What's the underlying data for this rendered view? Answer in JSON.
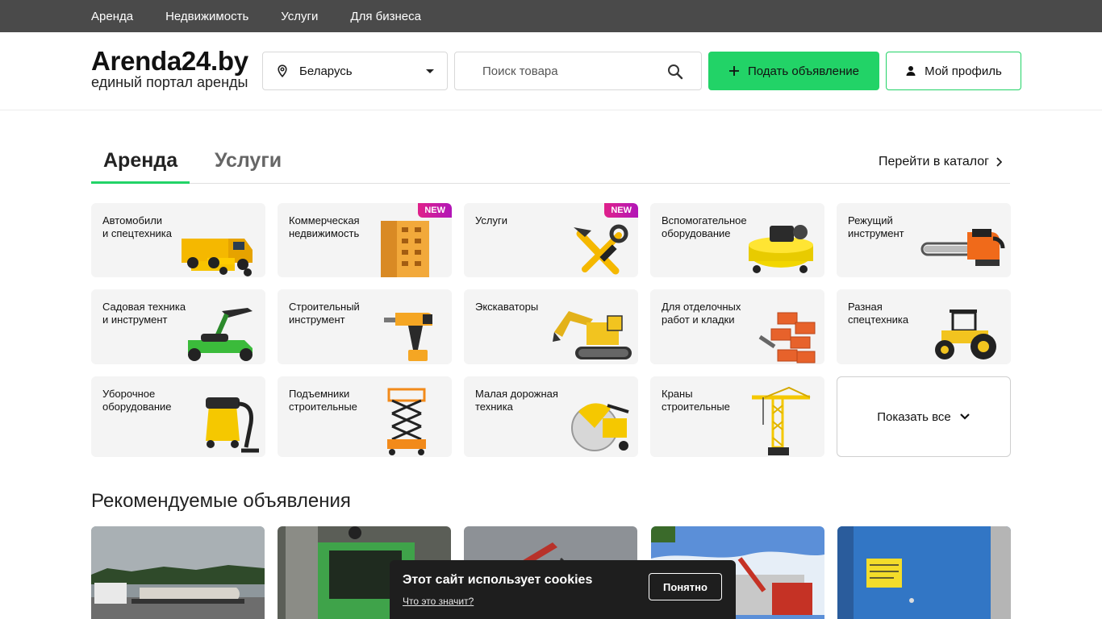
{
  "topnav": {
    "items": [
      {
        "label": "Аренда"
      },
      {
        "label": "Недвижимость"
      },
      {
        "label": "Услуги"
      },
      {
        "label": "Для бизнеса"
      }
    ]
  },
  "header": {
    "logo_title": "Arenda24.by",
    "logo_subtitle": "единый портал аренды",
    "region": "Беларусь",
    "search_placeholder": "Поиск товара",
    "post_button": "Подать объявление",
    "profile_button": "Мой профиль"
  },
  "tabs": {
    "active": "Аренда",
    "inactive": "Услуги",
    "catalog_link": "Перейти в каталог"
  },
  "categories": [
    {
      "label": "Автомобили\nи спецтехника",
      "icon": "dump-truck-icon",
      "new": false
    },
    {
      "label": "Коммерческая\nнедвижимость",
      "icon": "building-icon",
      "new": true
    },
    {
      "label": "Услуги",
      "icon": "hammer-wrench-icon",
      "new": true
    },
    {
      "label": "Вспомогательное\nоборудование",
      "icon": "compressor-icon",
      "new": false
    },
    {
      "label": "Режущий\nинструмент",
      "icon": "chainsaw-icon",
      "new": false
    },
    {
      "label": "Садовая техника\nи инструмент",
      "icon": "lawnmower-icon",
      "new": false
    },
    {
      "label": "Строительный\nинструмент",
      "icon": "drill-icon",
      "new": false
    },
    {
      "label": "Экскаваторы",
      "icon": "excavator-icon",
      "new": false
    },
    {
      "label": "Для отделочных\nработ и кладки",
      "icon": "bricks-icon",
      "new": false
    },
    {
      "label": "Разная\nспецтехника",
      "icon": "tractor-icon",
      "new": false
    },
    {
      "label": "Уборочное\nоборудование",
      "icon": "vacuum-icon",
      "new": false
    },
    {
      "label": "Подъемники\nстроительные",
      "icon": "scissor-lift-icon",
      "new": false
    },
    {
      "label": "Малая дорожная\nтехника",
      "icon": "road-saw-icon",
      "new": false
    },
    {
      "label": "Краны\nстроительные",
      "icon": "tower-crane-icon",
      "new": false
    }
  ],
  "new_badge": "NEW",
  "show_all": "Показать все",
  "recommended": {
    "title": "Рекомендуемые объявления"
  },
  "cookie": {
    "title": "Этот сайт использует cookies",
    "more": "Что это значит?",
    "ok": "Понятно"
  },
  "colors": {
    "accent": "#22d367",
    "topnav_bg": "#4a4a4a",
    "card_bg": "#f4f4f4",
    "cookie_bg": "#1e1e1e"
  }
}
